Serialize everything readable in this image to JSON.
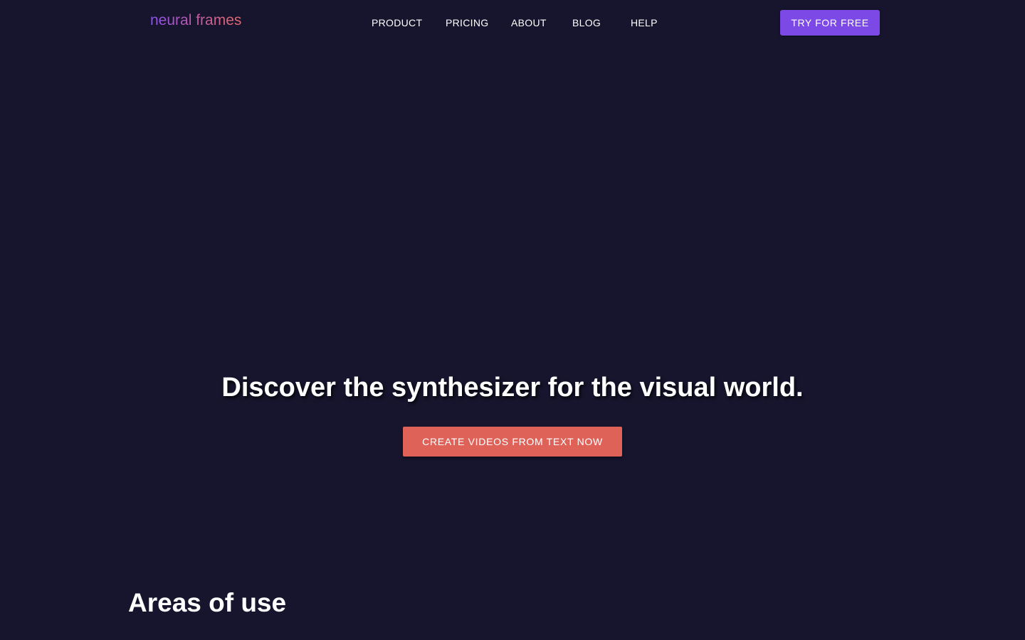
{
  "brand": {
    "logo_text": "neural frames",
    "logo_gradient": [
      "#8a4ff0",
      "#c45c9e",
      "#e0686a"
    ]
  },
  "nav": {
    "items": [
      {
        "label": "PRODUCT"
      },
      {
        "label": "PRICING"
      },
      {
        "label": "ABOUT"
      },
      {
        "label": "BLOG"
      },
      {
        "label": "HELP"
      }
    ],
    "cta_label": "TRY FOR FREE",
    "cta_color": "#7c49e6"
  },
  "hero": {
    "title": "Discover the synthesizer for the visual world.",
    "cta_label": "CREATE VIDEOS FROM TEXT NOW",
    "cta_color": "#df6259"
  },
  "sections": {
    "areas_heading": "Areas of use"
  },
  "theme": {
    "background": "#16152d"
  }
}
